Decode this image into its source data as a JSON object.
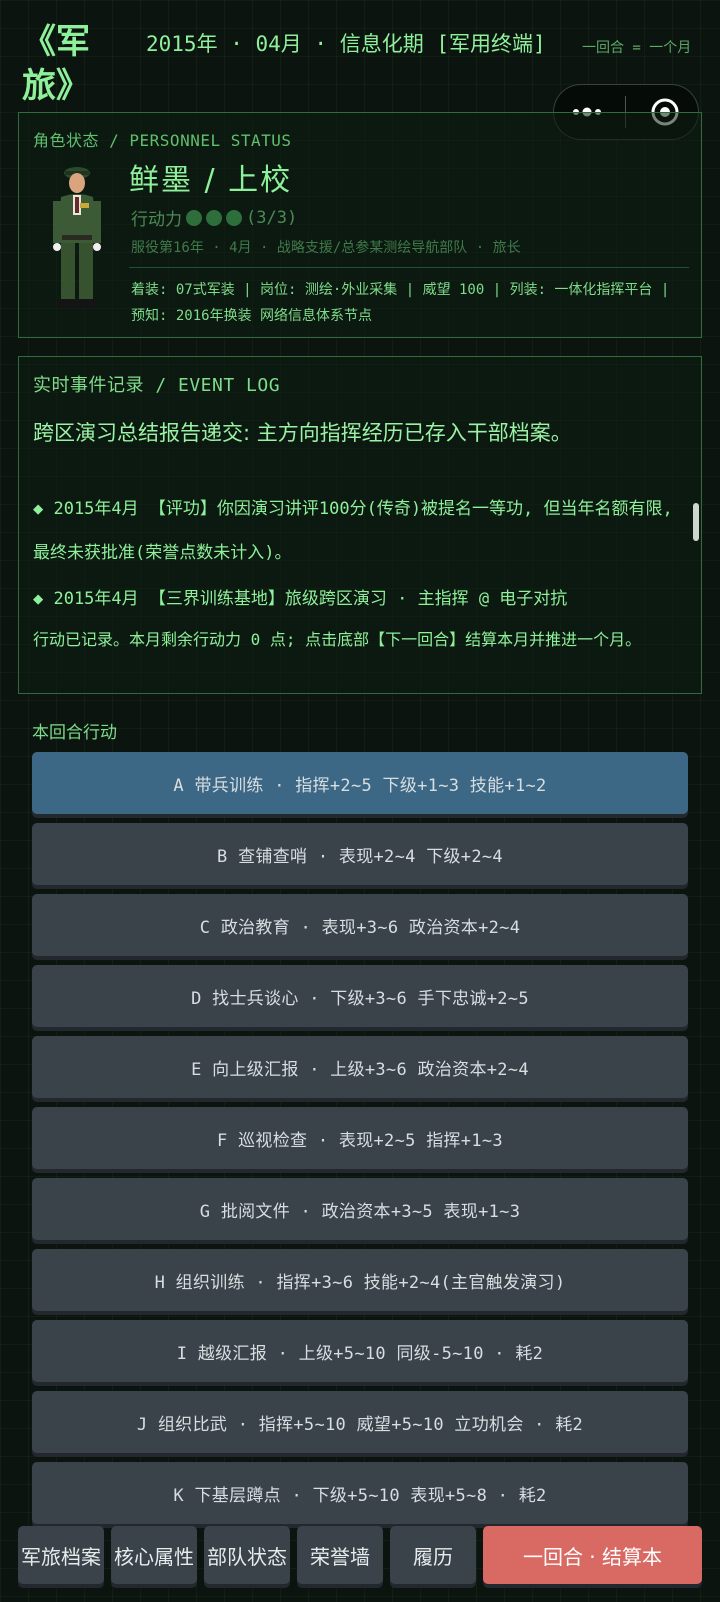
{
  "header": {
    "logo": "《军旅》",
    "date": "2015年 · 04月 · 信息化期 [军用终端]",
    "turn_note": "一回合 = 一个月"
  },
  "capsule": {
    "more_icon": "more-dots-icon",
    "close_icon": "target-circle-icon"
  },
  "status": {
    "title": "角色状态 / PERSONNEL STATUS",
    "name": "鲜墨  /  上校",
    "action_label": "行动力",
    "action_points": "(3/3)",
    "service": "服役第16年 · 4月 · 战略支援/总参某测绘导航部队 · 旅长",
    "equipment": "着装: 07式军装 | 岗位: 测绘·外业采集 | 威望 100 | 列装: 一体化指挥平台 | 预知: 2016年换装 网络信息体系节点"
  },
  "event_log": {
    "title": "实时事件记录 / EVENT LOG",
    "headline": "跨区演习总结报告递交: 主方向指挥经历已存入干部档案。",
    "entries": [
      "◆ 2015年4月 【评功】你因演习讲评100分(传奇)被提名一等功, 但当年名额有限, 最终未获批准(荣誉点数未计入)。",
      "◆ 2015年4月 【三界训练基地】旅级跨区演习 · 主指挥 @ 电子对抗"
    ],
    "note": "行动已记录。本月剩余行动力 0 点; 点击底部【下一回合】结算本月并推进一个月。"
  },
  "actions": {
    "title": "本回合行动",
    "items": [
      "A  带兵训练 · 指挥+2~5 下级+1~3 技能+1~2",
      "B  查铺查哨 · 表现+2~4 下级+2~4",
      "C  政治教育 · 表现+3~6 政治资本+2~4",
      "D  找士兵谈心 · 下级+3~6 手下忠诚+2~5",
      "E  向上级汇报 · 上级+3~6 政治资本+2~4",
      "F  巡视检查 · 表现+2~5 指挥+1~3",
      "G  批阅文件 · 政治资本+3~5 表现+1~3",
      "H  组织训练 · 指挥+3~6 技能+2~4(主官触发演习)",
      "I  越级汇报 · 上级+5~10 同级-5~10 · 耗2",
      "J  组织比武 · 指挥+5~10 威望+5~10 立功机会 · 耗2",
      "K  下基层蹲点 · 下级+5~10 表现+5~8 · 耗2"
    ],
    "selected": "A"
  },
  "bottom_tabs": {
    "archive": "军旅档案",
    "attributes": "核心属性",
    "unit": "部队状态",
    "honor": "荣誉墙",
    "history": "履历",
    "next_turn": "一回合 · 结算本"
  },
  "colors": {
    "background": "#0b140e",
    "accent_green": "#8ef09a",
    "selected_action": "#3c6886",
    "action_button": "#3a424a",
    "primary_button": "#d96a63"
  }
}
